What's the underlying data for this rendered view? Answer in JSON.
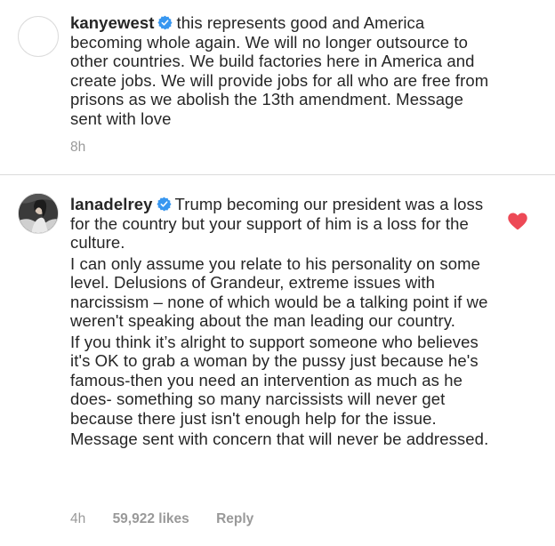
{
  "comments": [
    {
      "username": "kanyewest",
      "verified": true,
      "paragraphs": [
        "this represents good and America becoming whole again.  We will no longer outsource to other countries. We build factories here in America and create jobs.  We will provide jobs for all who are free from prisons as we abolish the 13th amendment. Message sent with love"
      ],
      "time": "8h",
      "avatar": "empty"
    },
    {
      "username": "lanadelrey",
      "verified": true,
      "paragraphs": [
        "Trump becoming our president was a loss for the country but your support of him is a loss for the culture.",
        "I can only assume you relate to his personality on some level. Delusions of Grandeur, extreme issues with narcissism – none of which would be a talking point if we weren't speaking about the man leading our country.",
        "If you think it’s alright to support someone who believes it's OK to grab a woman by the pussy just because he's famous-then you need an intervention as much as he does- something so many narcissists will never get because there just isn't enough help for the issue.",
        "Message sent with concern that will never be addressed."
      ],
      "time": "4h",
      "likes": "59,922 likes",
      "reply_label": "Reply",
      "liked": true,
      "avatar": "photo"
    }
  ],
  "colors": {
    "text": "#262626",
    "meta": "#999999",
    "verified": "#3897f0",
    "heart": "#ed4956",
    "divider": "#dbdbdb"
  },
  "icons": {
    "verified": "verified-badge-icon",
    "like": "heart-icon"
  }
}
